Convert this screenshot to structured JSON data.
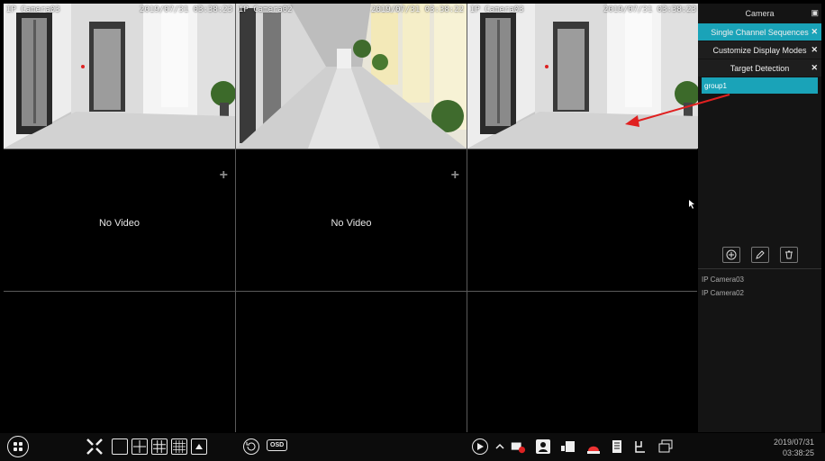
{
  "channels": [
    {
      "name": "IP Camera03",
      "time": "2019/07/31 03:38:23"
    },
    {
      "name": "IP Camera02",
      "time": "2019/07/31 03:38:22"
    },
    {
      "name": "IP Camera03",
      "time": "2019/07/31 03:38:23"
    }
  ],
  "no_video": "No Video",
  "panel": {
    "title": "Camera",
    "items": [
      {
        "label": "Single Channel Sequences"
      },
      {
        "label": "Customize Display Modes"
      },
      {
        "label": "Target Detection"
      }
    ],
    "groups": [
      "group1"
    ],
    "cameras": [
      "IP Camera03",
      "IP Camera02"
    ]
  },
  "toolbar": {
    "osd_label": "OSD",
    "date": "2019/07/31",
    "time": "03:38:25"
  },
  "colors": {
    "accent": "#1aa3b8",
    "annotation_arrow": "#e02020"
  }
}
